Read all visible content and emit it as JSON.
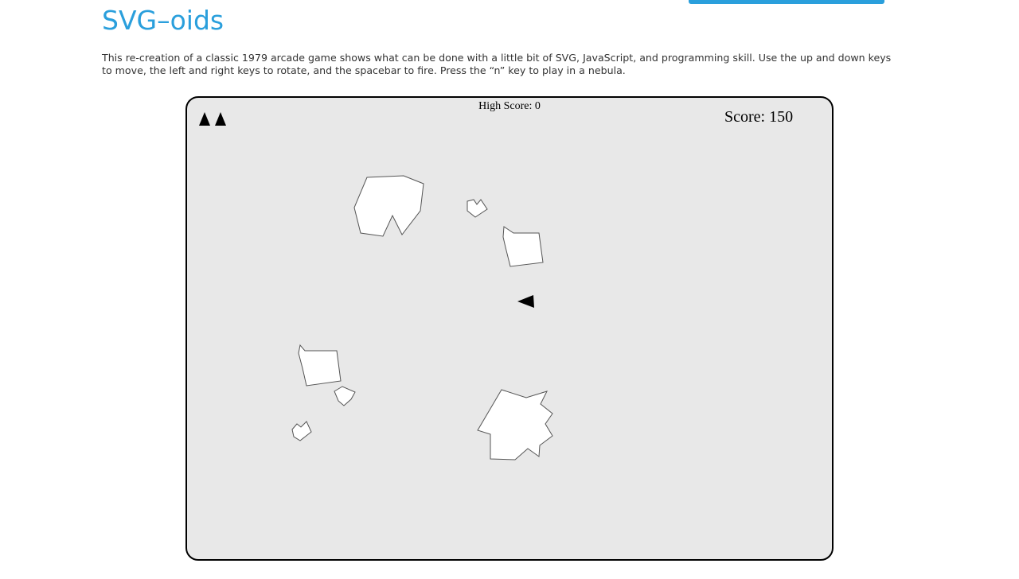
{
  "page": {
    "title": "SVG–oids",
    "intro": "This re-creation of a classic 1979 arcade game shows what can be done with a little bit of SVG, JavaScript, and programming skill. Use the up and down keys to move, the left and right keys to rotate, and the spacebar to fire. Press the “n” key to play in a nebula.",
    "accent_color": "#2a9fdc"
  },
  "game": {
    "high_score_text": "High Score: 0",
    "score_text": "Score: 150",
    "lives_remaining": 2,
    "playfield_color": "#e8e8e8",
    "asteroid_count": 7,
    "ship_icon": "ship-triangle-icon"
  }
}
